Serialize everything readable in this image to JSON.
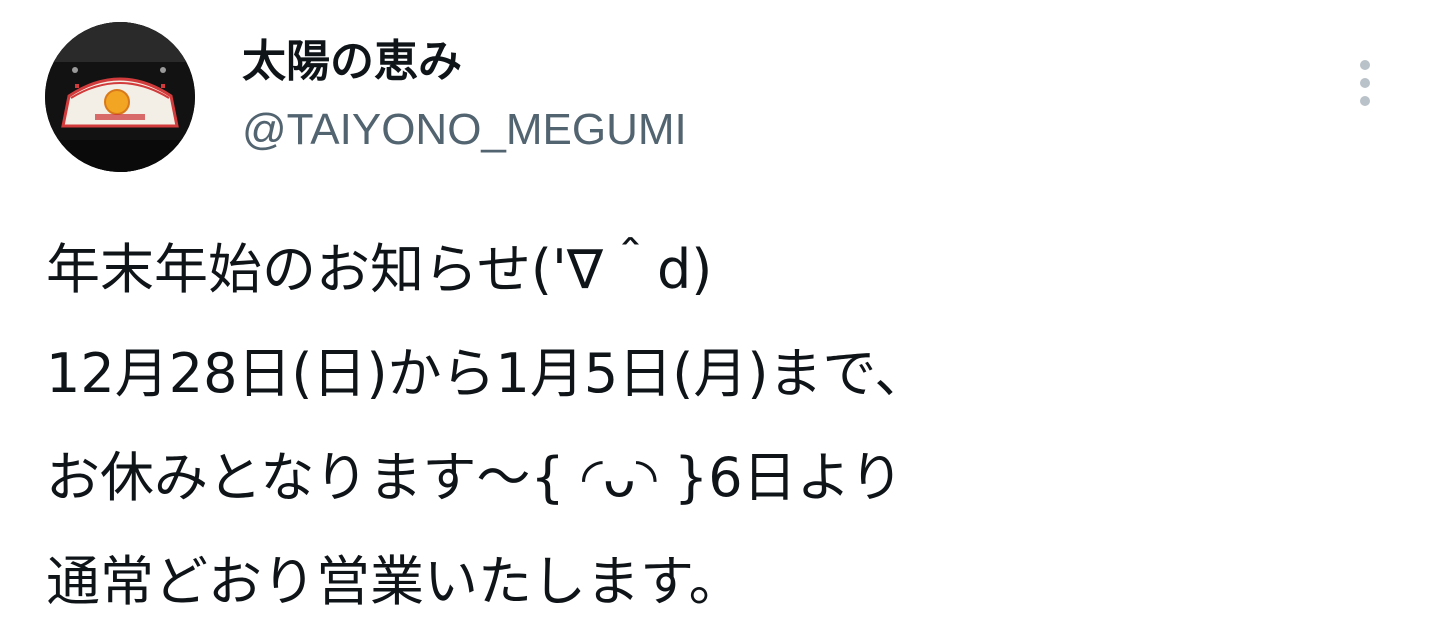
{
  "author": {
    "display_name": "太陽の恵み",
    "handle": "@TAIYONO_MEGUMI",
    "avatar_icon": "storefront-sign-avatar"
  },
  "tweet": {
    "lines": [
      "年末年始のお知らせ('∇＾d)",
      "12月28日(日)から1月5日(月)まで、",
      "お休みとなります〜{ ◜ᴗ◝ }6日より",
      "通常どおり営業いたします。"
    ]
  },
  "actions": {
    "more_icon": "more-vertical-icon"
  },
  "colors": {
    "text_primary": "#0f1419",
    "text_secondary": "#536471",
    "icon_muted": "#b9c2c9"
  }
}
